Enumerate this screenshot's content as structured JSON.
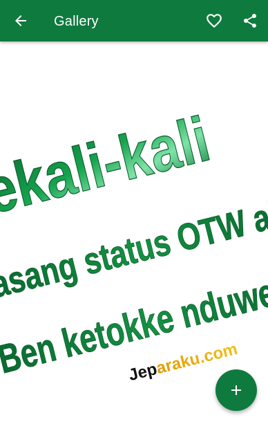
{
  "app_bar": {
    "title": "Gallery",
    "back_icon": "arrow-back-icon",
    "favorite_icon": "heart-outline-icon",
    "share_icon": "share-icon",
    "background_color": "#0f7a3e",
    "foreground_color": "#ffffff"
  },
  "image": {
    "lines": [
      "ekali-kali",
      "asang status OTW ah",
      "Ben ketokke nduwe d"
    ],
    "watermark": {
      "part1": "Jep",
      "part2": "araku.com"
    },
    "text_color": "#0c8a3a",
    "watermark_colors": [
      "#111111",
      "#e8a500"
    ]
  },
  "fab": {
    "icon": "plus-icon",
    "background_color": "#0f7a3e"
  }
}
